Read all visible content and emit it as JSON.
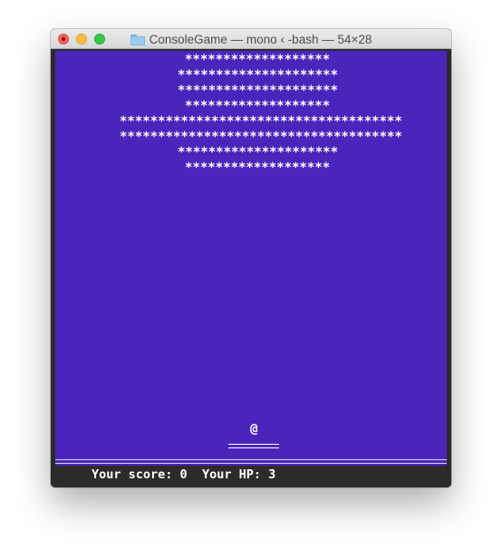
{
  "window": {
    "title": "ConsoleGame — mono ‹ -bash — 54×28",
    "folder_icon": "folder-icon"
  },
  "colors": {
    "playfield": "#4a25bb",
    "terminal_bg": "#2b2b2b",
    "text": "#ffffff"
  },
  "game": {
    "brick_rows": [
      "*******************",
      "*********************",
      "*********************",
      "*******************",
      "*************************************",
      "*************************************",
      "*********************",
      "*******************"
    ],
    "ball": "@",
    "paddle": "=======",
    "status": {
      "score_label": "Your score:",
      "score": "0",
      "hp_label": "Your HP:",
      "hp": "3"
    }
  }
}
